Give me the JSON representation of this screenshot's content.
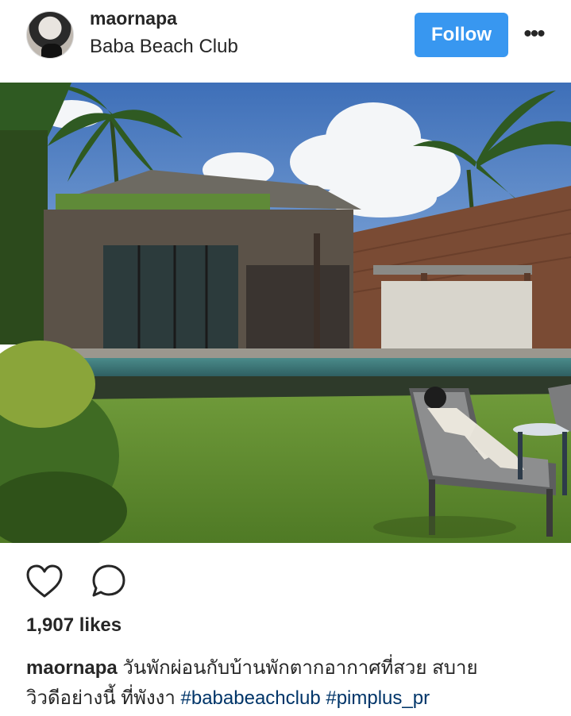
{
  "post": {
    "username": "maornapa",
    "location": "Baba Beach Club",
    "follow_label": "Follow",
    "more_label": "•••",
    "likes": "1,907 likes",
    "caption_user": "maornapa",
    "caption_text_line1": "วันพักผ่อนกับบ้านพักตากอากาศที่สวย สบาย",
    "caption_text_line2": "วิวดีอย่างนี้ ที่พังงา",
    "hashtag_1": "#bababeachclub",
    "hashtag_2": "#pimplus_pr"
  },
  "icons": {
    "like": "heart-outline-icon",
    "comment": "speech-bubble-icon",
    "more": "ellipsis-icon"
  },
  "colors": {
    "follow_button": "#3897f0",
    "hashtag": "#003569",
    "text": "#262626"
  }
}
